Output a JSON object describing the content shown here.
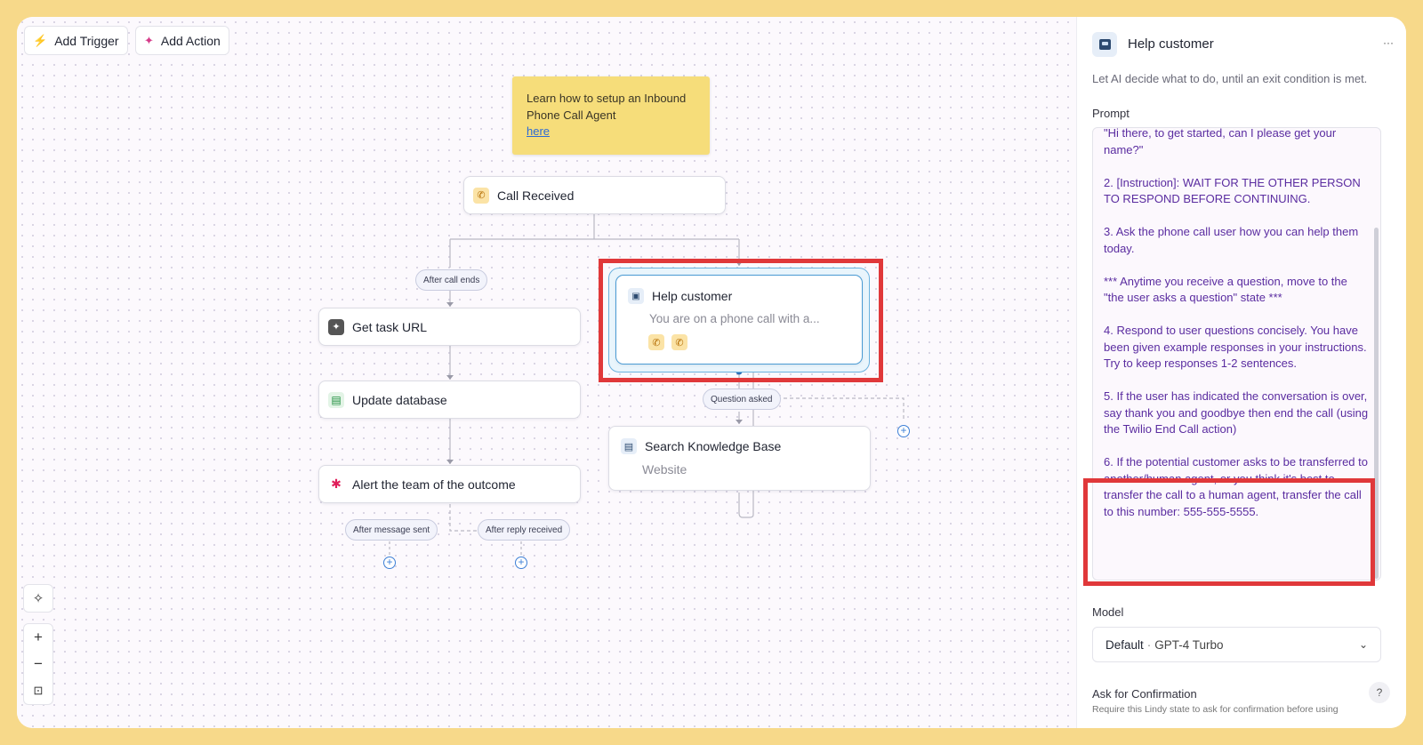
{
  "toolbar": {
    "add_trigger": "Add Trigger",
    "add_action": "Add Action"
  },
  "note": {
    "text": "Learn how to setup an Inbound Phone Call Agent",
    "link": "here"
  },
  "nodes": {
    "call_received": "Call Received",
    "get_task_url": "Get task URL",
    "update_database": "Update database",
    "alert_team": "Alert the team of the outcome",
    "help_customer_title": "Help customer",
    "help_customer_sub": "You are on a phone call with a...",
    "search_kb_title": "Search Knowledge Base",
    "search_kb_sub": "Website"
  },
  "edges": {
    "after_call_ends": "After call ends",
    "question_asked": "Question asked",
    "after_message_sent": "After message sent",
    "after_reply_received": "After reply received"
  },
  "zoom_controls": [
    "+",
    "−"
  ],
  "panel": {
    "title": "Help customer",
    "menu": "···",
    "description": "Let AI decide what to do, until an exit condition is met.",
    "prompt_label": "Prompt",
    "prompt_paragraphs": [
      "\"Hi there, to get started, can I please get your name?\"\n",
      "2. [Instruction]: WAIT FOR THE OTHER PERSON TO RESPOND BEFORE CONTINUING.",
      "3. Ask the phone call user how you can help them today.",
      "*** Anytime you receive a question, move to the \"the user asks a question\" state ***",
      "4. Respond to user questions concisely. You have been given example responses in your instructions. Try to keep responses 1-2 sentences.",
      "5. If the user has indicated the conversation is over, say thank you and goodbye then end the call (using the Twilio End Call action)",
      "6. If the potential customer asks to be transferred to another/human agent, or you think it's best to transfer the call to a human agent, transfer the call to this number: 555-555-5555."
    ],
    "model_label": "Model",
    "model_default": "Default",
    "model_name": "GPT-4 Turbo",
    "confirm_label": "Ask for Confirmation",
    "confirm_desc": "Require this Lindy state to ask for confirmation before using",
    "help": "?"
  }
}
